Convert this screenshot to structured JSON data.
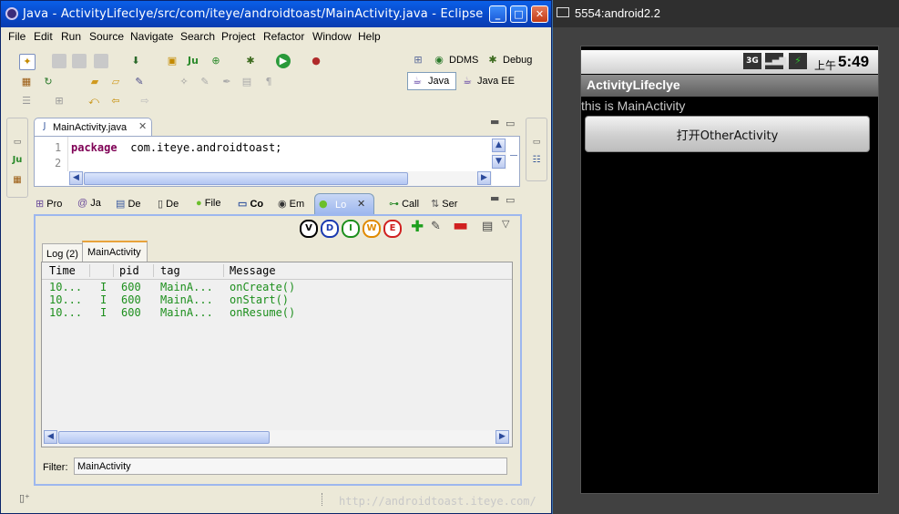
{
  "eclipse": {
    "title": "Java - ActivityLifeclye/src/com/iteye/androidtoast/MainActivity.java - Eclipse",
    "menu": [
      "File",
      "Edit",
      "Run",
      "Source",
      "Navigate",
      "Search",
      "Project",
      "Refactor",
      "Window",
      "Help"
    ],
    "perspectives": {
      "ddms": "DDMS",
      "debug": "Debug",
      "java": "Java",
      "java_ee": "Java EE"
    },
    "editor": {
      "tab_label": "MainActivity.java",
      "lines": [
        {
          "num": "1",
          "keyword": "package",
          "text": " com.iteye.androidtoast;"
        },
        {
          "num": "2",
          "keyword": "",
          "text": ""
        }
      ]
    },
    "bottom_tabs": [
      "Pro",
      "Ja",
      "De",
      "De",
      "File",
      "Co",
      "Em",
      "Lo",
      "Call",
      "Ser"
    ],
    "logcat": {
      "filter_icons": [
        "V",
        "D",
        "I",
        "W",
        "E"
      ],
      "subtabs": [
        "Log (2)",
        "MainActivity"
      ],
      "columns": [
        "Time",
        "",
        "pid",
        "tag",
        "Message"
      ],
      "rows": [
        {
          "time": "10...",
          "level": "I",
          "pid": "600",
          "tag": "MainA...",
          "message": "onCreate()"
        },
        {
          "time": "10...",
          "level": "I",
          "pid": "600",
          "tag": "MainA...",
          "message": "onStart()"
        },
        {
          "time": "10...",
          "level": "I",
          "pid": "600",
          "tag": "MainA...",
          "message": "onResume()"
        }
      ],
      "filter_label": "Filter:",
      "filter_value": "MainActivity"
    },
    "watermark": "http://androidtoast.iteye.com/"
  },
  "emulator": {
    "title": "5554:android2.2",
    "status": {
      "network": "3G",
      "ampm": "上午",
      "time": "5:49"
    },
    "app_title": "ActivityLifeclye",
    "body_text": "this is MainActivity",
    "button_label": "打开OtherActivity"
  }
}
